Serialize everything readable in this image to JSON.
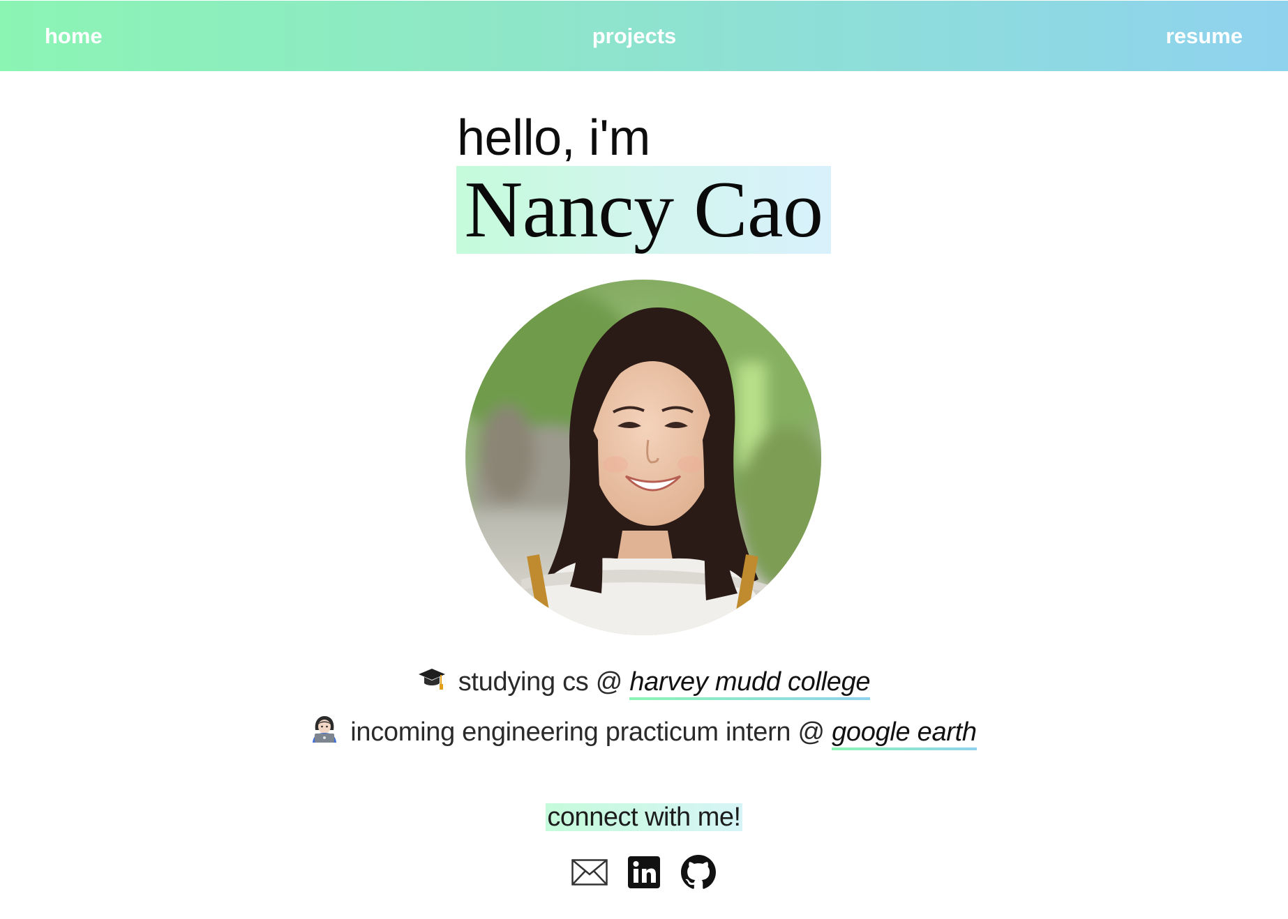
{
  "nav": {
    "home": "home",
    "projects": "projects",
    "resume": "resume"
  },
  "hero": {
    "greeting": "hello, i'm",
    "name": "Nancy Cao"
  },
  "info": [
    {
      "emoji": "graduation-cap-icon",
      "text": "studying cs @ ",
      "link": "harvey mudd college"
    },
    {
      "emoji": "woman-technologist-icon",
      "text": "incoming engineering practicum intern @ ",
      "link": "google earth"
    }
  ],
  "connect": {
    "label": "connect with me!",
    "icons": [
      "mail-icon",
      "linkedin-icon",
      "github-icon"
    ]
  },
  "colors": {
    "gradient_start": "#8bf5b4",
    "gradient_end": "#8fd2ee",
    "highlight_start": "#c5fbdb",
    "highlight_end": "#d8f1fb"
  }
}
